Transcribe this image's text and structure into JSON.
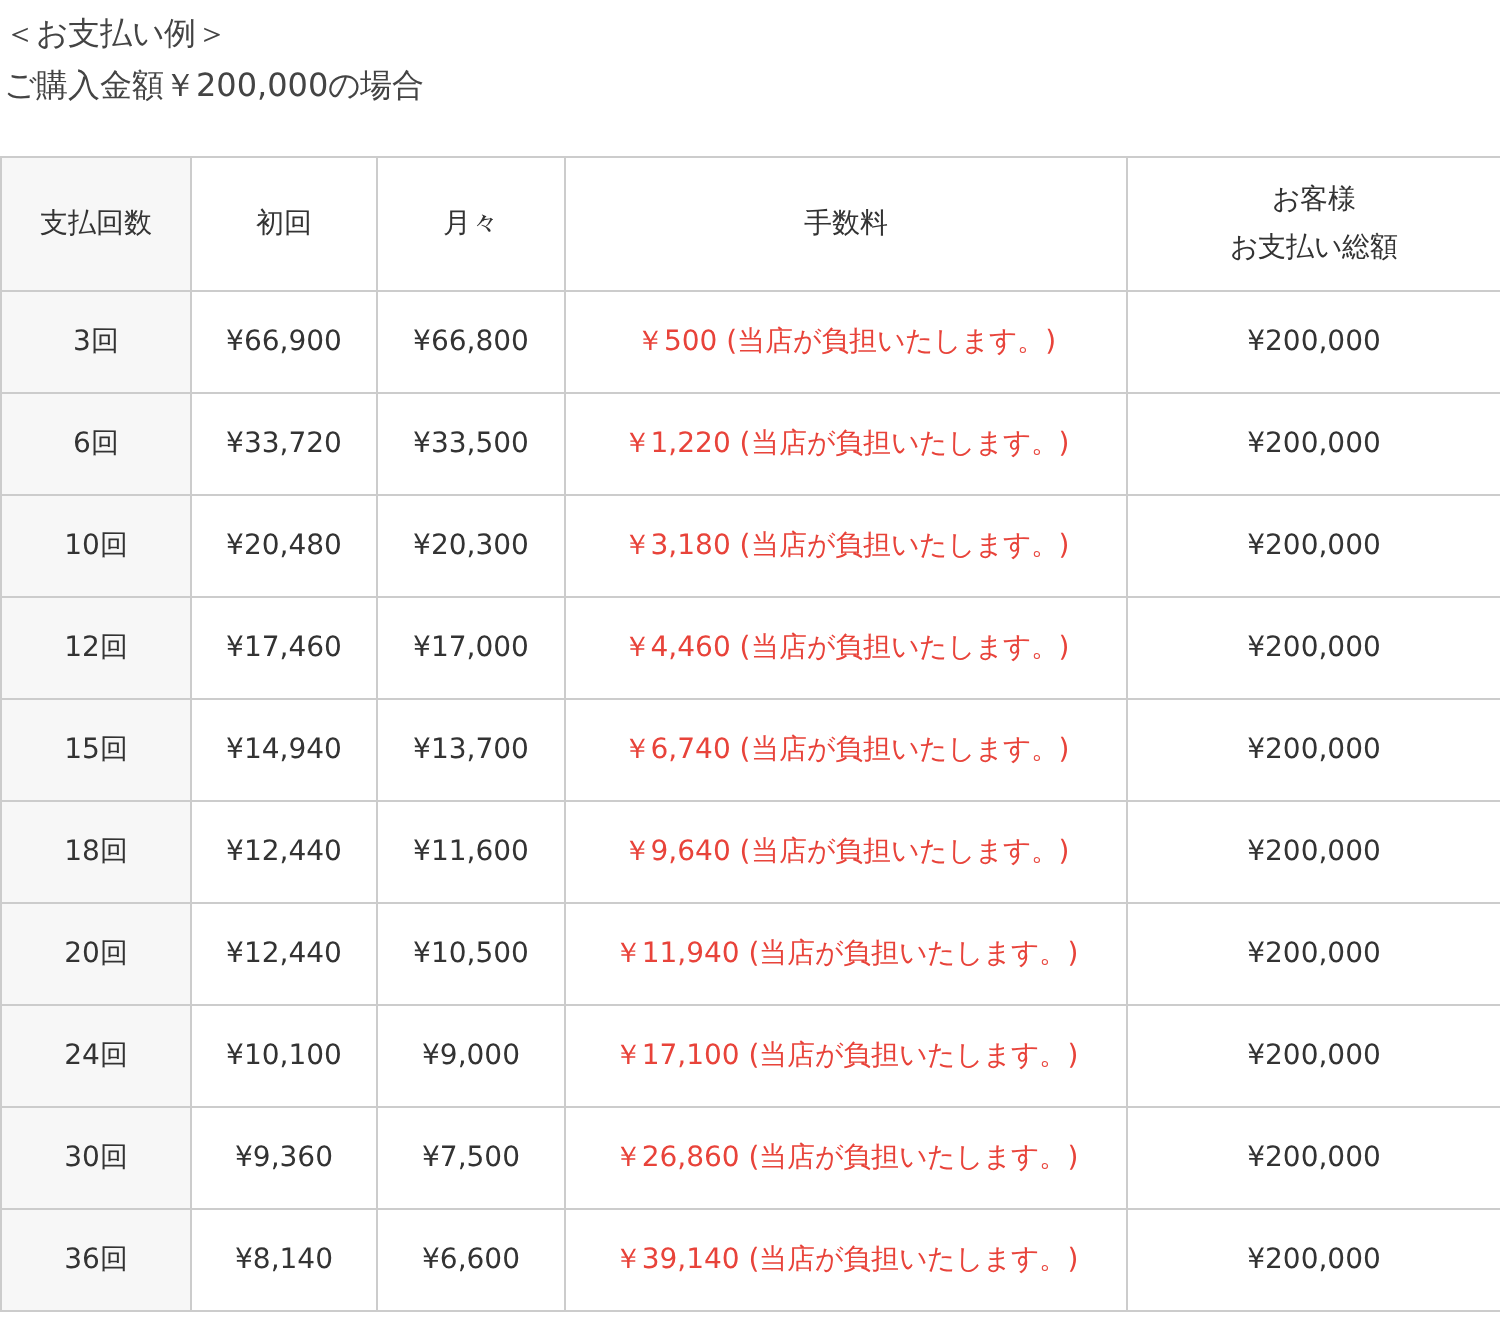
{
  "heading": {
    "title": "＜お支払い例＞",
    "subtitle": "ご購入金額￥200,000の場合"
  },
  "table": {
    "columns": [
      {
        "label": "支払回数"
      },
      {
        "label": "初回"
      },
      {
        "label": "月々"
      },
      {
        "label": "手数料"
      },
      {
        "label": "お客様",
        "sublabel": "お支払い総額"
      }
    ],
    "rows": [
      [
        "3回",
        "¥66,900",
        "¥66,800",
        "￥500 (当店が負担いたします。)",
        "¥200,000"
      ],
      [
        "6回",
        "¥33,720",
        "¥33,500",
        "￥1,220 (当店が負担いたします。)",
        "¥200,000"
      ],
      [
        "10回",
        "¥20,480",
        "¥20,300",
        "￥3,180 (当店が負担いたします。)",
        "¥200,000"
      ],
      [
        "12回",
        "¥17,460",
        "¥17,000",
        "￥4,460 (当店が負担いたします。)",
        "¥200,000"
      ],
      [
        "15回",
        "¥14,940",
        "¥13,700",
        "￥6,740 (当店が負担いたします。)",
        "¥200,000"
      ],
      [
        "18回",
        "¥12,440",
        "¥11,600",
        "￥9,640 (当店が負担いたします。)",
        "¥200,000"
      ],
      [
        "20回",
        "¥12,440",
        "¥10,500",
        "￥11,940 (当店が負担いたします。)",
        "¥200,000"
      ],
      [
        "24回",
        "¥10,100",
        "¥9,000",
        "￥17,100 (当店が負担いたします。)",
        "¥200,000"
      ],
      [
        "30回",
        "¥9,360",
        "¥7,500",
        "￥26,860 (当店が負担いたします。)",
        "¥200,000"
      ],
      [
        "36回",
        "¥8,140",
        "¥6,600",
        "￥39,140 (当店が負担いたします。)",
        "¥200,000"
      ]
    ]
  }
}
